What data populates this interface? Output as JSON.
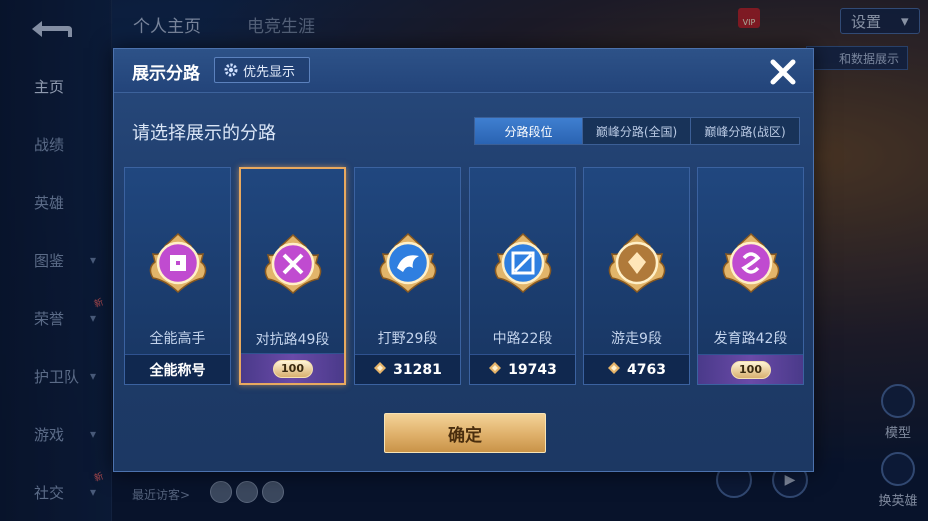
{
  "background": {
    "sidebar": [
      {
        "label": "主页",
        "active": true
      },
      {
        "label": "战绩"
      },
      {
        "label": "英雄"
      },
      {
        "label": "图鉴",
        "chevron": true
      },
      {
        "label": "荣誉",
        "chevron": true,
        "new": true
      },
      {
        "label": "护卫队",
        "chevron": true
      },
      {
        "label": "游戏",
        "chevron": true
      },
      {
        "label": "社交",
        "chevron": true,
        "new": true
      }
    ],
    "new_tag": "新",
    "top_tabs": [
      "个人主页",
      "电竞生涯"
    ],
    "vip_badge": "VIP",
    "settings_label": "设置",
    "right_tab_label": "和数据展示",
    "recent_visitors_label": "最近访客>",
    "right_controls": [
      "模型",
      "换英雄"
    ]
  },
  "modal": {
    "title": "展示分路",
    "priority_button": "优先显示",
    "prompt": "请选择展示的分路",
    "segments": [
      {
        "label": "分路段位",
        "active": true
      },
      {
        "label": "巅峰分路(全国)"
      },
      {
        "label": "巅峰分路(战区)"
      }
    ],
    "cards": [
      {
        "name": "全能高手",
        "footer_text": "全能称号",
        "footer_type": "text",
        "emblem": "allround-emblem-icon",
        "color": "#c04bd0"
      },
      {
        "name": "对抗路49段",
        "footer_text": "100",
        "footer_type": "badge",
        "emblem": "clash-lane-emblem-icon",
        "color": "#c04bd0",
        "selected": true
      },
      {
        "name": "打野29段",
        "footer_text": "31281",
        "footer_type": "score",
        "emblem": "jungle-emblem-icon",
        "color": "#2f7fe0"
      },
      {
        "name": "中路22段",
        "footer_text": "19743",
        "footer_type": "score",
        "emblem": "mid-lane-emblem-icon",
        "color": "#2f7fe0"
      },
      {
        "name": "游走9段",
        "footer_text": "4763",
        "footer_type": "score",
        "emblem": "roam-emblem-icon",
        "color": "#b07a3a"
      },
      {
        "name": "发育路42段",
        "footer_text": "100",
        "footer_type": "badge",
        "emblem": "farm-lane-emblem-icon",
        "color": "#c04bd0"
      }
    ],
    "confirm_label": "确定"
  },
  "colors": {
    "accent_gold": "#e8a95f",
    "segment_active": "#3f7fd0",
    "modal_bg": "#1f3d6c"
  }
}
